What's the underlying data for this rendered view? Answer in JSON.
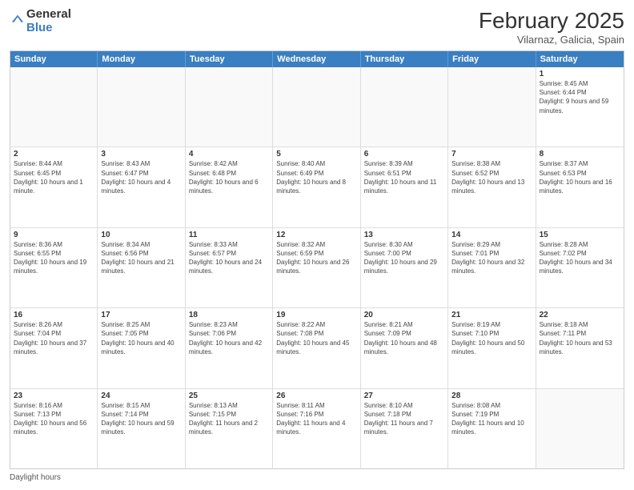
{
  "header": {
    "logo_general": "General",
    "logo_blue": "Blue",
    "month_year": "February 2025",
    "location": "Vilarnaz, Galicia, Spain"
  },
  "days_of_week": [
    "Sunday",
    "Monday",
    "Tuesday",
    "Wednesday",
    "Thursday",
    "Friday",
    "Saturday"
  ],
  "footer": {
    "daylight_label": "Daylight hours"
  },
  "weeks": [
    {
      "days": [
        {
          "num": "",
          "info": ""
        },
        {
          "num": "",
          "info": ""
        },
        {
          "num": "",
          "info": ""
        },
        {
          "num": "",
          "info": ""
        },
        {
          "num": "",
          "info": ""
        },
        {
          "num": "",
          "info": ""
        },
        {
          "num": "1",
          "info": "Sunrise: 8:45 AM\nSunset: 6:44 PM\nDaylight: 9 hours and 59 minutes."
        }
      ]
    },
    {
      "days": [
        {
          "num": "2",
          "info": "Sunrise: 8:44 AM\nSunset: 6:45 PM\nDaylight: 10 hours and 1 minute."
        },
        {
          "num": "3",
          "info": "Sunrise: 8:43 AM\nSunset: 6:47 PM\nDaylight: 10 hours and 4 minutes."
        },
        {
          "num": "4",
          "info": "Sunrise: 8:42 AM\nSunset: 6:48 PM\nDaylight: 10 hours and 6 minutes."
        },
        {
          "num": "5",
          "info": "Sunrise: 8:40 AM\nSunset: 6:49 PM\nDaylight: 10 hours and 8 minutes."
        },
        {
          "num": "6",
          "info": "Sunrise: 8:39 AM\nSunset: 6:51 PM\nDaylight: 10 hours and 11 minutes."
        },
        {
          "num": "7",
          "info": "Sunrise: 8:38 AM\nSunset: 6:52 PM\nDaylight: 10 hours and 13 minutes."
        },
        {
          "num": "8",
          "info": "Sunrise: 8:37 AM\nSunset: 6:53 PM\nDaylight: 10 hours and 16 minutes."
        }
      ]
    },
    {
      "days": [
        {
          "num": "9",
          "info": "Sunrise: 8:36 AM\nSunset: 6:55 PM\nDaylight: 10 hours and 19 minutes."
        },
        {
          "num": "10",
          "info": "Sunrise: 8:34 AM\nSunset: 6:56 PM\nDaylight: 10 hours and 21 minutes."
        },
        {
          "num": "11",
          "info": "Sunrise: 8:33 AM\nSunset: 6:57 PM\nDaylight: 10 hours and 24 minutes."
        },
        {
          "num": "12",
          "info": "Sunrise: 8:32 AM\nSunset: 6:59 PM\nDaylight: 10 hours and 26 minutes."
        },
        {
          "num": "13",
          "info": "Sunrise: 8:30 AM\nSunset: 7:00 PM\nDaylight: 10 hours and 29 minutes."
        },
        {
          "num": "14",
          "info": "Sunrise: 8:29 AM\nSunset: 7:01 PM\nDaylight: 10 hours and 32 minutes."
        },
        {
          "num": "15",
          "info": "Sunrise: 8:28 AM\nSunset: 7:02 PM\nDaylight: 10 hours and 34 minutes."
        }
      ]
    },
    {
      "days": [
        {
          "num": "16",
          "info": "Sunrise: 8:26 AM\nSunset: 7:04 PM\nDaylight: 10 hours and 37 minutes."
        },
        {
          "num": "17",
          "info": "Sunrise: 8:25 AM\nSunset: 7:05 PM\nDaylight: 10 hours and 40 minutes."
        },
        {
          "num": "18",
          "info": "Sunrise: 8:23 AM\nSunset: 7:06 PM\nDaylight: 10 hours and 42 minutes."
        },
        {
          "num": "19",
          "info": "Sunrise: 8:22 AM\nSunset: 7:08 PM\nDaylight: 10 hours and 45 minutes."
        },
        {
          "num": "20",
          "info": "Sunrise: 8:21 AM\nSunset: 7:09 PM\nDaylight: 10 hours and 48 minutes."
        },
        {
          "num": "21",
          "info": "Sunrise: 8:19 AM\nSunset: 7:10 PM\nDaylight: 10 hours and 50 minutes."
        },
        {
          "num": "22",
          "info": "Sunrise: 8:18 AM\nSunset: 7:11 PM\nDaylight: 10 hours and 53 minutes."
        }
      ]
    },
    {
      "days": [
        {
          "num": "23",
          "info": "Sunrise: 8:16 AM\nSunset: 7:13 PM\nDaylight: 10 hours and 56 minutes."
        },
        {
          "num": "24",
          "info": "Sunrise: 8:15 AM\nSunset: 7:14 PM\nDaylight: 10 hours and 59 minutes."
        },
        {
          "num": "25",
          "info": "Sunrise: 8:13 AM\nSunset: 7:15 PM\nDaylight: 11 hours and 2 minutes."
        },
        {
          "num": "26",
          "info": "Sunrise: 8:11 AM\nSunset: 7:16 PM\nDaylight: 11 hours and 4 minutes."
        },
        {
          "num": "27",
          "info": "Sunrise: 8:10 AM\nSunset: 7:18 PM\nDaylight: 11 hours and 7 minutes."
        },
        {
          "num": "28",
          "info": "Sunrise: 8:08 AM\nSunset: 7:19 PM\nDaylight: 11 hours and 10 minutes."
        },
        {
          "num": "",
          "info": ""
        }
      ]
    }
  ]
}
